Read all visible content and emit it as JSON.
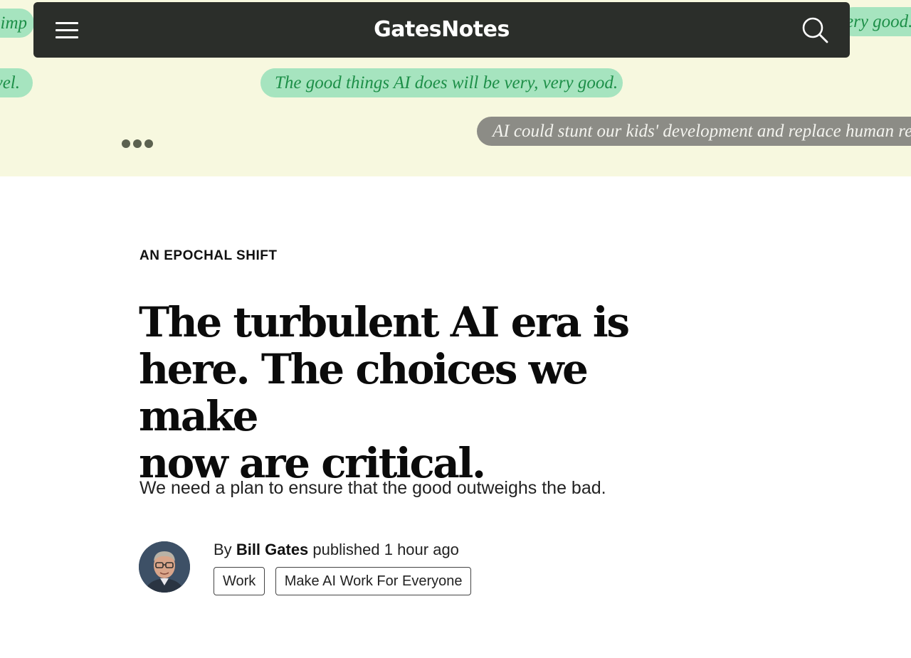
{
  "hero": {
    "bubbles": [
      {
        "text": "n imp"
      },
      {
        "text": "ery good."
      },
      {
        "text": "vel."
      },
      {
        "text": "The good things AI does will be very, very good."
      },
      {
        "text": "AI could stunt our kids' development and replace human re"
      }
    ],
    "colors": {
      "background": "#f7f8df",
      "green_bubble": "#a6e4bf",
      "green_text": "#1d8f48",
      "gray_bubble": "#8c8c86"
    }
  },
  "nav": {
    "logo": "GatesNotes",
    "menu_icon": "hamburger-menu-icon",
    "search_icon": "search-icon",
    "background": "#2b2e2a"
  },
  "article": {
    "kicker": "AN EPOCHAL SHIFT",
    "headline_lines": [
      "The turbulent AI era is",
      "here. The choices we make",
      "now are critical."
    ],
    "subhead": "We need a plan to ensure that the good outweighs the bad.",
    "byline": {
      "prefix": "By",
      "author": "Bill Gates",
      "published": "published 1 hour ago"
    },
    "tags": [
      "Work",
      "Make AI Work For Everyone"
    ]
  }
}
